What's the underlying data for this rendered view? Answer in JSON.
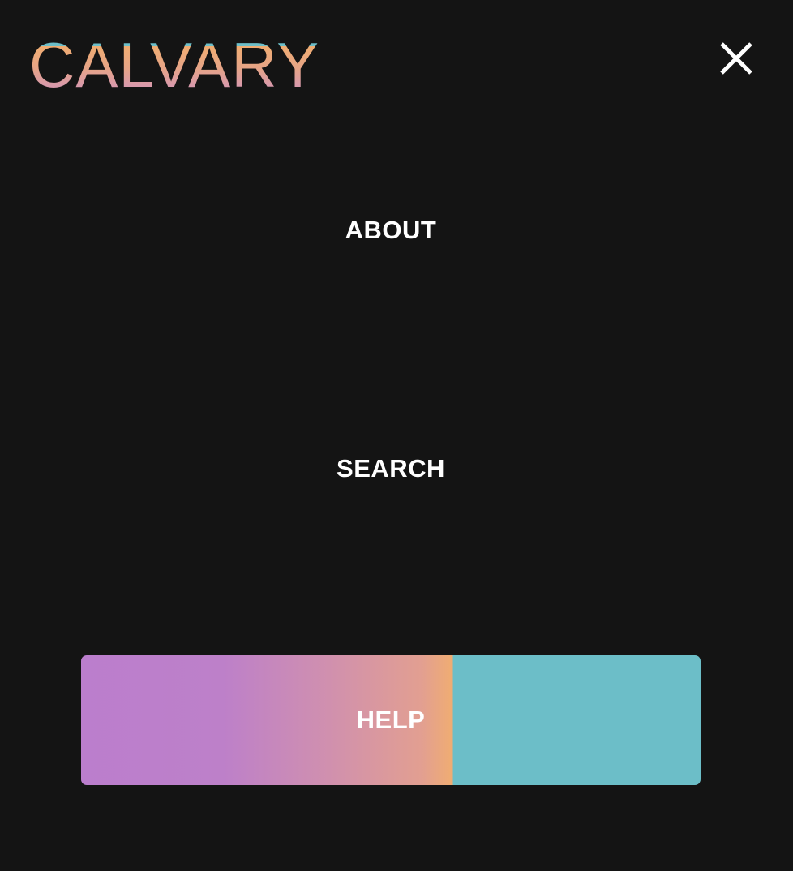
{
  "header": {
    "logo_text": "CALVARY",
    "close_icon": "close-icon"
  },
  "menu": {
    "items": [
      {
        "label": "ABOUT"
      },
      {
        "label": "SEARCH"
      }
    ],
    "help_label": "HELP"
  },
  "colors": {
    "background": "#141414",
    "text": "#ffffff",
    "accent_teal": "#6cbec8",
    "accent_orange": "#f0ad72",
    "accent_pink": "#d99aa9",
    "accent_purple": "#bb7ecd"
  }
}
